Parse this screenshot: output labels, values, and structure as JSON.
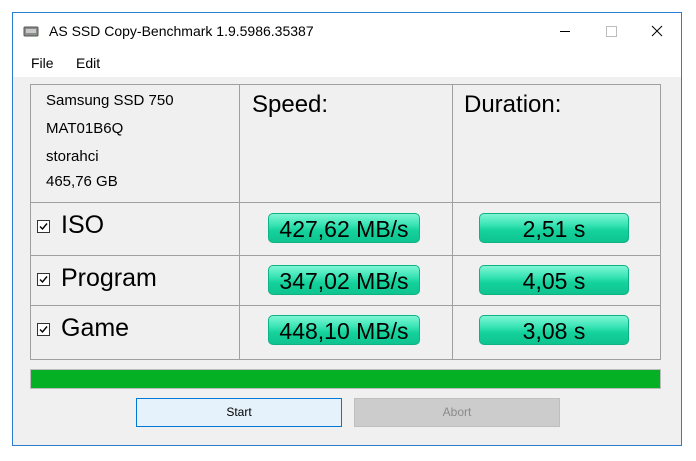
{
  "window": {
    "title": "AS SSD Copy-Benchmark 1.9.5986.35387",
    "controls": [
      "minimize-icon",
      "maximize-icon",
      "close-icon"
    ]
  },
  "menu": {
    "items": [
      "File",
      "Edit"
    ]
  },
  "drive": {
    "model": "Samsung SSD 750",
    "firmware": "MAT01B6Q",
    "driver": "storahci",
    "size": "465,76 GB"
  },
  "headers": {
    "speed": "Speed:",
    "duration": "Duration:"
  },
  "tests": [
    {
      "label": "ISO",
      "checked": true,
      "speed": "427,62 MB/s",
      "duration": "2,51 s"
    },
    {
      "label": "Program",
      "checked": true,
      "speed": "347,02 MB/s",
      "duration": "4,05 s"
    },
    {
      "label": "Game",
      "checked": true,
      "speed": "448,10 MB/s",
      "duration": "3,08 s"
    }
  ],
  "progress": {
    "fraction": 1.0,
    "color": "#06b025"
  },
  "result_color": "#14d29c",
  "buttons": {
    "start": "Start",
    "abort": "Abort"
  }
}
